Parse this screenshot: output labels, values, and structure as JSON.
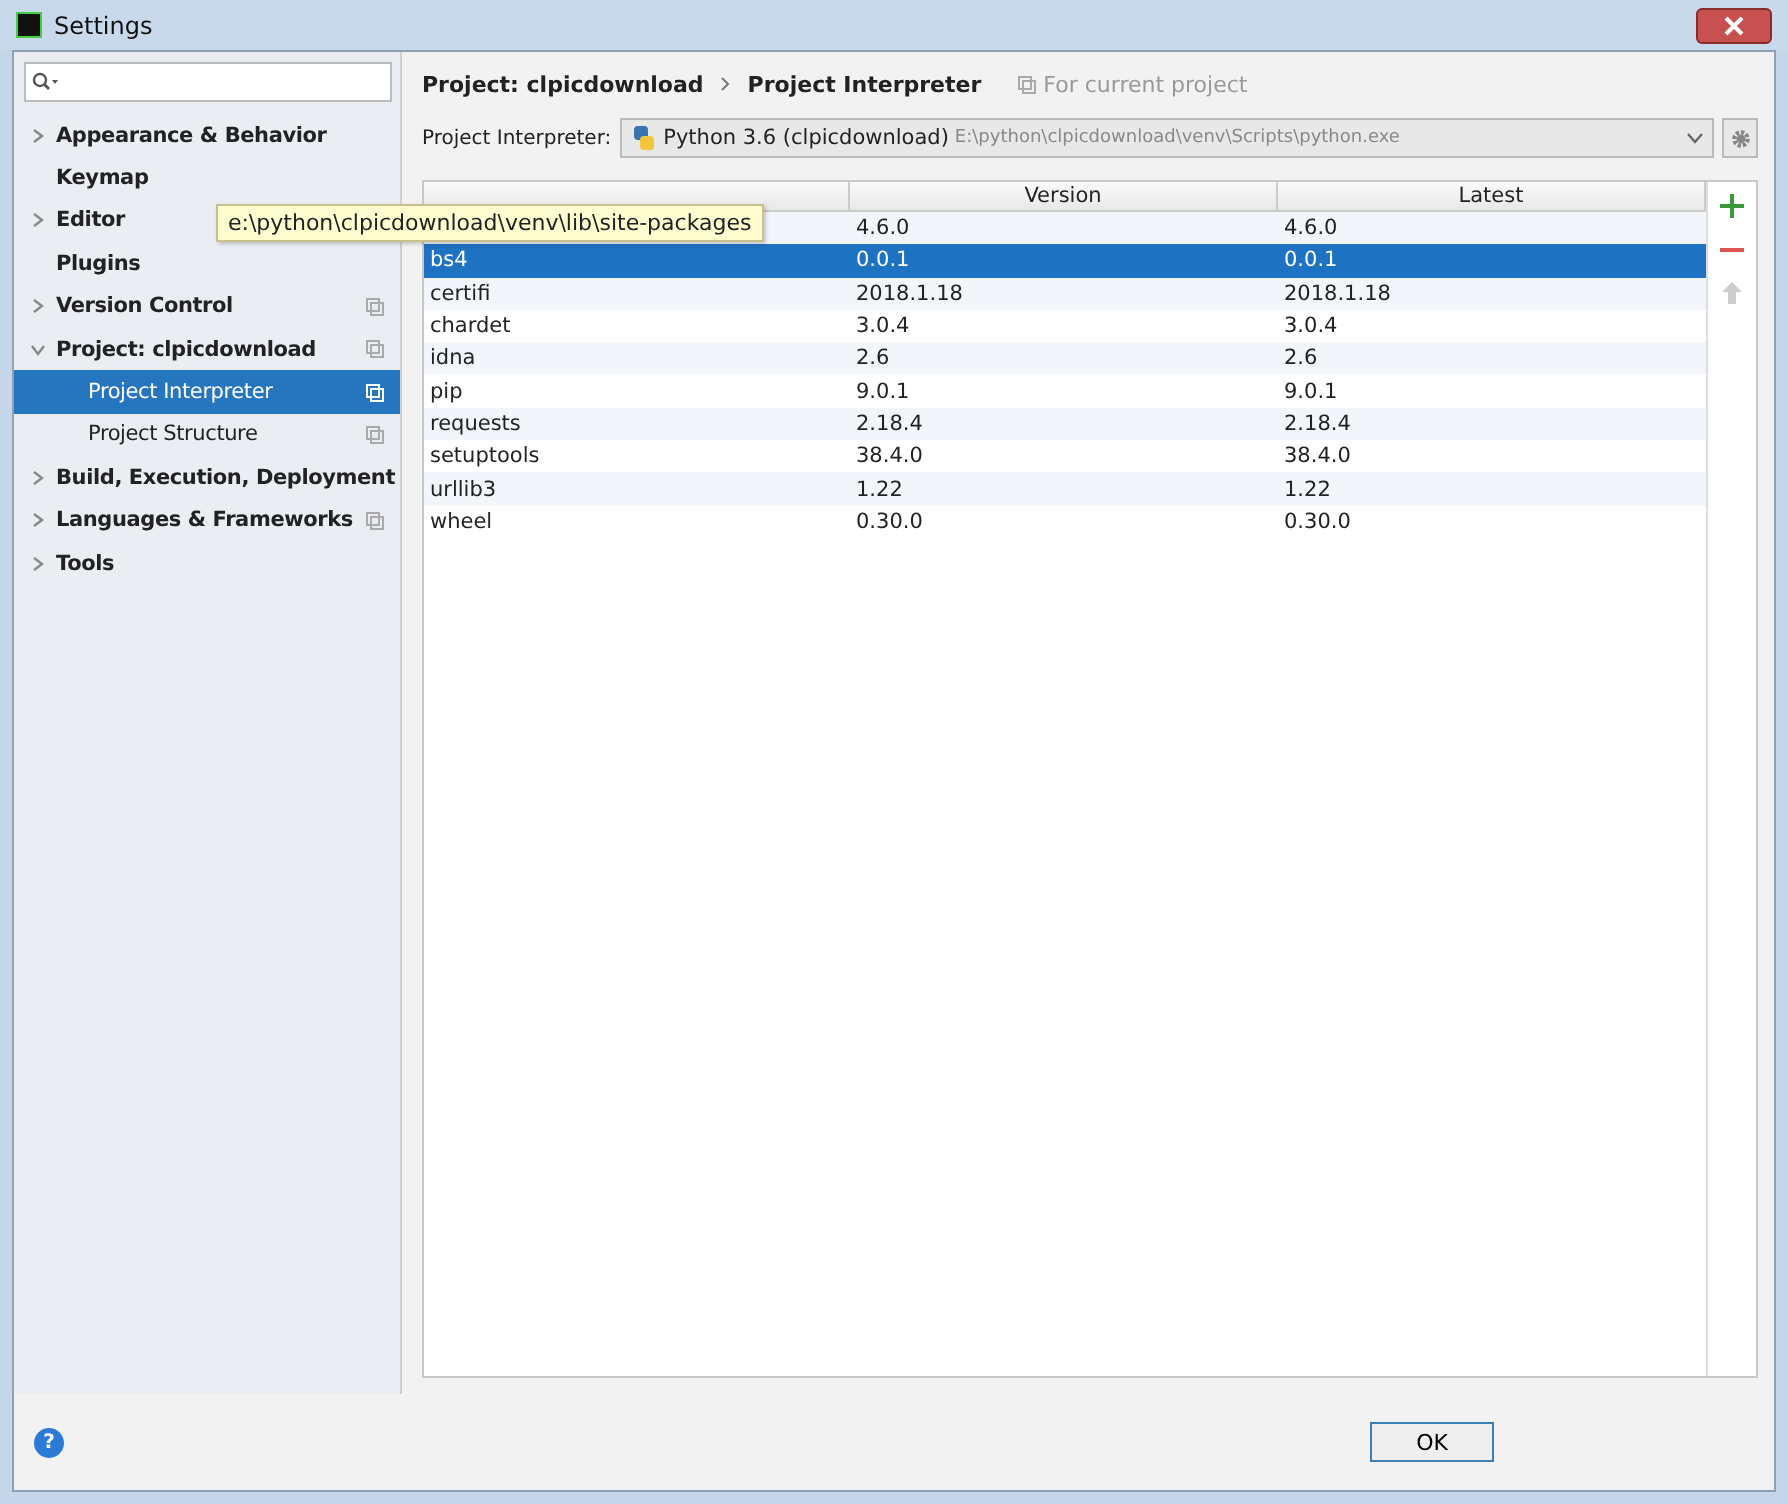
{
  "window": {
    "title": "Settings"
  },
  "sidebar": {
    "items": [
      {
        "label": "Appearance & Behavior",
        "kind": "group",
        "expanded": false,
        "project_icon": false,
        "selected": false
      },
      {
        "label": "Keymap",
        "project_icon": false,
        "selected": false
      },
      {
        "label": "Editor",
        "kind": "group",
        "expanded": false,
        "project_icon": false,
        "selected": false
      },
      {
        "label": "Plugins",
        "project_icon": false,
        "selected": false
      },
      {
        "label": "Version Control",
        "kind": "group",
        "expanded": false,
        "project_icon": true,
        "selected": false
      },
      {
        "label": "Project: clpicdownload",
        "kind": "group",
        "expanded": true,
        "project_icon": true,
        "selected": false,
        "children": [
          {
            "label": "Project Interpreter",
            "project_icon": true,
            "selected": true
          },
          {
            "label": "Project Structure",
            "project_icon": true,
            "selected": false
          }
        ]
      },
      {
        "label": "Build, Execution, Deployment",
        "kind": "group",
        "expanded": false,
        "project_icon": false,
        "selected": false
      },
      {
        "label": "Languages & Frameworks",
        "kind": "group",
        "expanded": false,
        "project_icon": true,
        "selected": false
      },
      {
        "label": "Tools",
        "kind": "group",
        "expanded": false,
        "project_icon": false,
        "selected": false
      }
    ]
  },
  "breadcrumb": [
    "Project: clpicdownload",
    "Project Interpreter"
  ],
  "scope_note": "For current project",
  "interpreter": {
    "label": "Project Interpreter:",
    "name": "Python 3.6 (clpicdownload)",
    "path": "E:\\python\\clpicdownload\\venv\\Scripts\\python.exe"
  },
  "table": {
    "columns": [
      "Version",
      "Latest"
    ],
    "rows": [
      {
        "version": "4.6.0",
        "latest": "4.6.0",
        "selected": false
      },
      {
        "package": "bs4",
        "version": "0.0.1",
        "latest": "0.0.1",
        "selected": true
      },
      {
        "package": "certifi",
        "version": "2018.1.18",
        "latest": "2018.1.18",
        "selected": false
      },
      {
        "package": "chardet",
        "version": "3.0.4",
        "latest": "3.0.4",
        "selected": false
      },
      {
        "package": "idna",
        "version": "2.6",
        "latest": "2.6",
        "selected": false
      },
      {
        "package": "pip",
        "version": "9.0.1",
        "latest": "9.0.1",
        "selected": false
      },
      {
        "package": "requests",
        "version": "2.18.4",
        "latest": "2.18.4",
        "selected": false
      },
      {
        "package": "setuptools",
        "version": "38.4.0",
        "latest": "38.4.0",
        "selected": false
      },
      {
        "package": "urllib3",
        "version": "1.22",
        "latest": "1.22",
        "selected": false
      },
      {
        "package": "wheel",
        "version": "0.30.0",
        "latest": "0.30.0",
        "selected": false
      }
    ]
  },
  "tooltip": "e:\\python\\clpicdownload\\venv\\lib\\site-packages",
  "help": "?",
  "buttons": [
    "OK"
  ]
}
